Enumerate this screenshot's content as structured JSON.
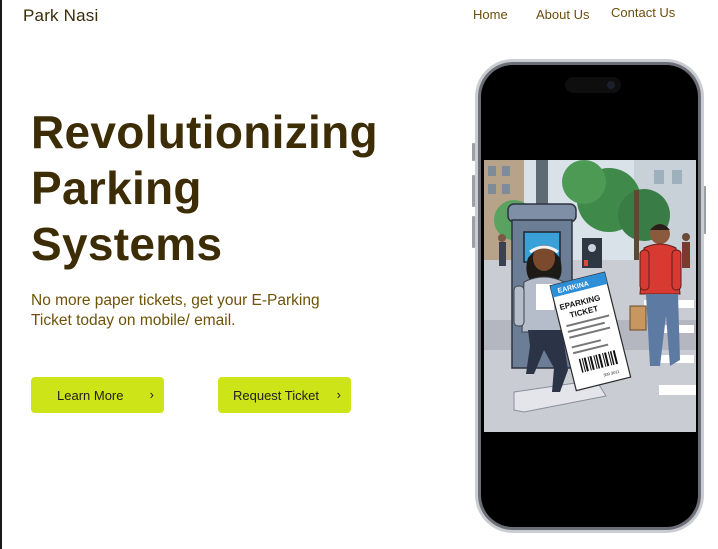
{
  "brand": {
    "name": "Park Nasi"
  },
  "nav": {
    "home": "Home",
    "about": "About Us",
    "contact": "Contact Us"
  },
  "hero": {
    "title_line1": "Revolutionizing",
    "title_line2": "Parking",
    "title_line3": "Systems",
    "subtitle_line1": "No more paper tickets, get your E-Parking",
    "subtitle_line2": "Ticket today on mobile/ email."
  },
  "buttons": {
    "learn_more": "Learn More",
    "request_ticket": "Request Ticket",
    "chevron": "›"
  },
  "illustration": {
    "ticket_header": "EARKINA",
    "ticket_title_1": "EPARKING",
    "ticket_title_2": "TICKET",
    "ticket_number": "300 3011"
  },
  "colors": {
    "accent": "#cde419",
    "title": "#3d2d07",
    "subtitle": "#6e5208",
    "nav": "#6b4e0c"
  },
  "icons": {
    "chevron": "chevron-right-icon"
  }
}
